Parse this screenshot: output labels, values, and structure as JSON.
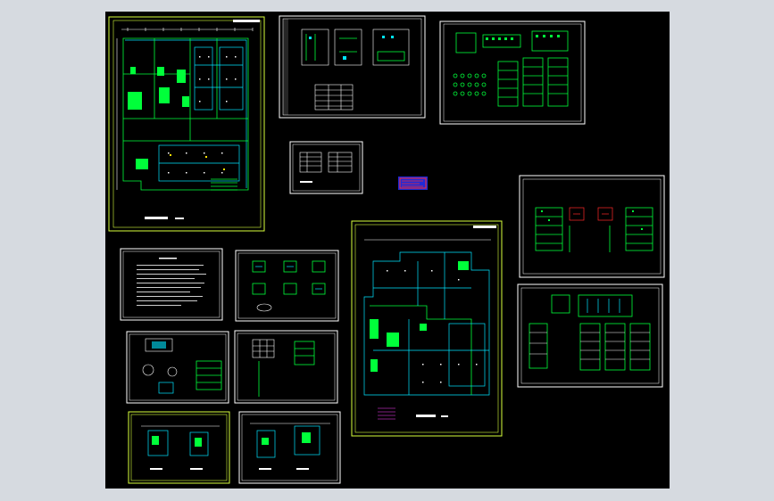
{
  "viewer": {
    "background": "#000000",
    "outer_background": "#d6dae0"
  },
  "colors": {
    "frame": "#ffffff",
    "frame_alt": "#d8ff3c",
    "wire_green": "#00ff3a",
    "wire_cyan": "#00e5ff",
    "text_white": "#ffffff",
    "highlight_red": "#ff2a2a",
    "logo_blue": "#1f2ad8"
  },
  "sheets": [
    {
      "id": "floor-plan-1",
      "kind": "floor-plan",
      "frame": "yellow"
    },
    {
      "id": "system-diagram-1",
      "kind": "schematic"
    },
    {
      "id": "panel-schedule-1",
      "kind": "schedule"
    },
    {
      "id": "legend-table",
      "kind": "table"
    },
    {
      "id": "title-logo",
      "kind": "logo"
    },
    {
      "id": "distribution-diagram-1",
      "kind": "schematic"
    },
    {
      "id": "design-notes",
      "kind": "notes"
    },
    {
      "id": "detail-sheet-1",
      "kind": "details"
    },
    {
      "id": "floor-plan-2",
      "kind": "floor-plan",
      "frame": "yellow"
    },
    {
      "id": "distribution-diagram-2",
      "kind": "schematic"
    },
    {
      "id": "equipment-detail",
      "kind": "details"
    },
    {
      "id": "grid-detail",
      "kind": "details"
    },
    {
      "id": "partial-plan-1",
      "kind": "partial-plan",
      "frame": "yellow"
    },
    {
      "id": "partial-plan-2",
      "kind": "partial-plan"
    }
  ]
}
